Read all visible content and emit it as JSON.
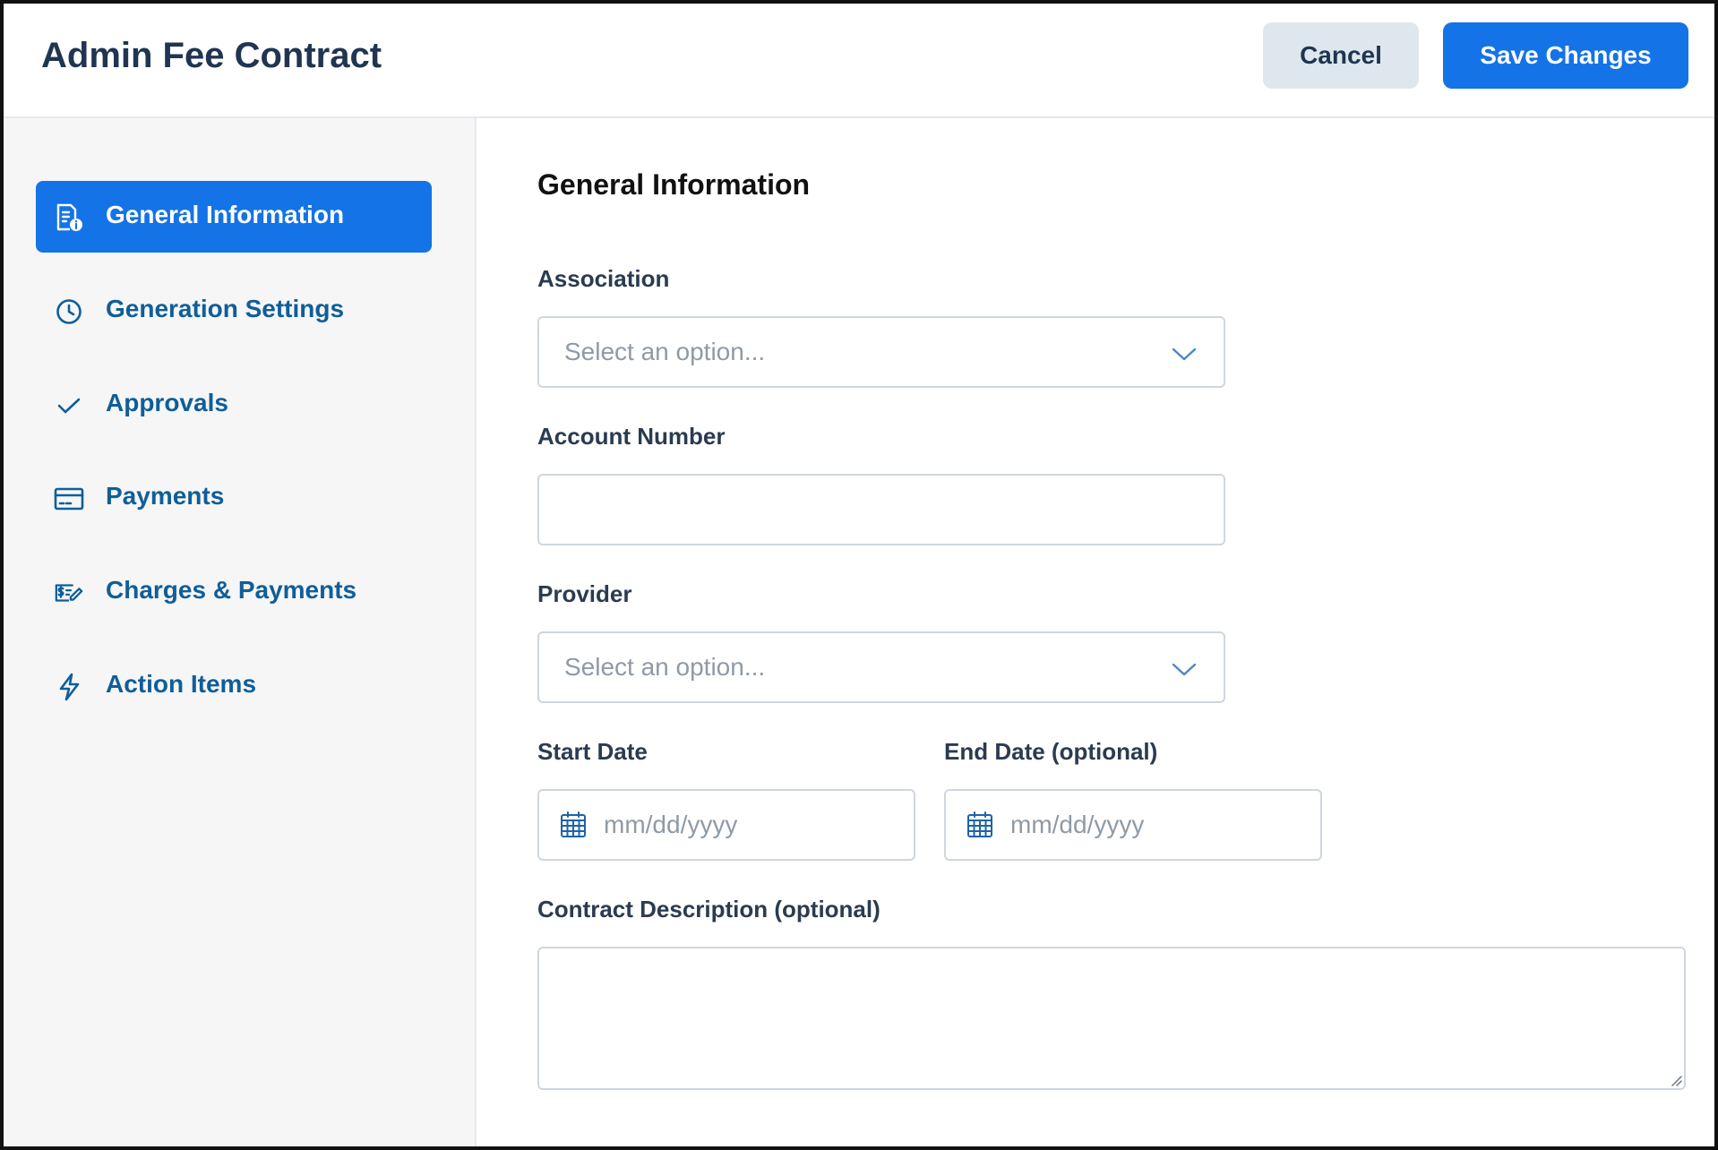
{
  "header": {
    "title": "Admin Fee Contract",
    "cancel_label": "Cancel",
    "save_label": "Save Changes"
  },
  "sidebar": {
    "items": [
      {
        "label": "General Information",
        "icon": "document-info-icon",
        "active": true
      },
      {
        "label": "Generation Settings",
        "icon": "clock-icon",
        "active": false
      },
      {
        "label": "Approvals",
        "icon": "checkmark-icon",
        "active": false
      },
      {
        "label": "Payments",
        "icon": "credit-card-icon",
        "active": false
      },
      {
        "label": "Charges & Payments",
        "icon": "money-edit-icon",
        "active": false
      },
      {
        "label": "Action Items",
        "icon": "lightning-icon",
        "active": false
      }
    ]
  },
  "main": {
    "section_title": "General Information",
    "association": {
      "label": "Association",
      "placeholder": "Select an option..."
    },
    "account_number": {
      "label": "Account Number",
      "value": ""
    },
    "provider": {
      "label": "Provider",
      "placeholder": "Select an option..."
    },
    "start_date": {
      "label": "Start Date",
      "placeholder": "mm/dd/yyyy"
    },
    "end_date": {
      "label": "End Date (optional)",
      "placeholder": "mm/dd/yyyy"
    },
    "description": {
      "label": "Contract Description (optional)",
      "value": ""
    }
  },
  "colors": {
    "accent": "#1473e6",
    "nav_text": "#0f5e99",
    "title_text": "#1f3552",
    "sidebar_bg": "#f6f6f7",
    "cancel_bg": "#dfe7ee",
    "placeholder": "#8f9aa6"
  }
}
